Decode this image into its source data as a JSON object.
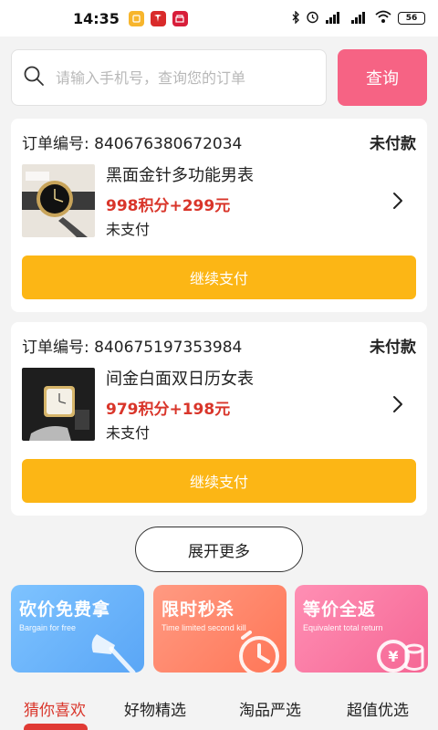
{
  "status_bar": {
    "time": "14:35",
    "battery": "56",
    "network_label": "HD"
  },
  "search": {
    "placeholder": "请输入手机号，查询您的订单",
    "value": "",
    "button_label": "查询"
  },
  "orders": [
    {
      "order_no_label": "订单编号: 840676380672034",
      "status": "未付款",
      "product_name": "黑面金针多功能男表",
      "price": "998积分+299元",
      "payment_state": "未支付",
      "action_label": "继续支付"
    },
    {
      "order_no_label": "订单编号: 840675197353984",
      "status": "未付款",
      "product_name": "间金白面双日历女表",
      "price": "979积分+198元",
      "payment_state": "未支付",
      "action_label": "继续支付"
    }
  ],
  "expand_label": "展开更多",
  "promos": [
    {
      "title": "砍价免费拿",
      "subtitle": "Bargain for free",
      "icon": "axe-icon",
      "color": "#6fb6fb"
    },
    {
      "title": "限时秒杀",
      "subtitle": "Time limited second kill",
      "icon": "clock-icon",
      "color": "#ff8466"
    },
    {
      "title": "等价全返",
      "subtitle": "Equivalent total return",
      "icon": "yuan-coins-icon",
      "color": "#f77aa2"
    }
  ],
  "tabs": [
    {
      "label": "猜你喜欢",
      "active": true
    },
    {
      "label": "好物精选",
      "active": false
    },
    {
      "label": "淘品严选",
      "active": false
    },
    {
      "label": "超值优选",
      "active": false
    }
  ],
  "colors": {
    "accent_pink": "#f66384",
    "button_yellow": "#fcb615",
    "price_red": "#d9352a",
    "tab_active_red": "#d9352a"
  }
}
